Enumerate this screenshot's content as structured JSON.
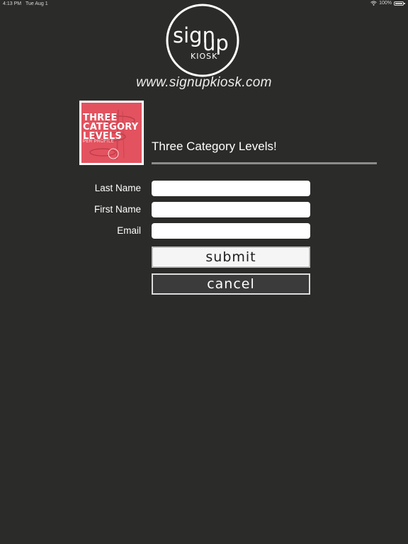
{
  "status_bar": {
    "time": "4:13 PM",
    "date": "Tue Aug 1",
    "battery": "100%",
    "wifi_icon": "wifi-icon",
    "battery_icon": "battery-icon"
  },
  "logo": {
    "line1": "sign",
    "line2": "up",
    "line3": "KIOSK"
  },
  "website": "www.signupkiosk.com",
  "event": {
    "thumbnail": {
      "line1": "THREE",
      "line2": "CATEGORY",
      "line3": "LEVELS",
      "sub": "PER PROFILE",
      "background": "#e3525f"
    },
    "title": "Three Category Levels!"
  },
  "form": {
    "fields": [
      {
        "label": "Last Name",
        "value": ""
      },
      {
        "label": "First Name",
        "value": ""
      },
      {
        "label": "Email",
        "value": ""
      }
    ],
    "submit_label": "submit",
    "cancel_label": "cancel"
  },
  "colors": {
    "background": "#2b2b29",
    "accent_rule": "#8c8c8c",
    "thumbnail": "#e3525f"
  }
}
